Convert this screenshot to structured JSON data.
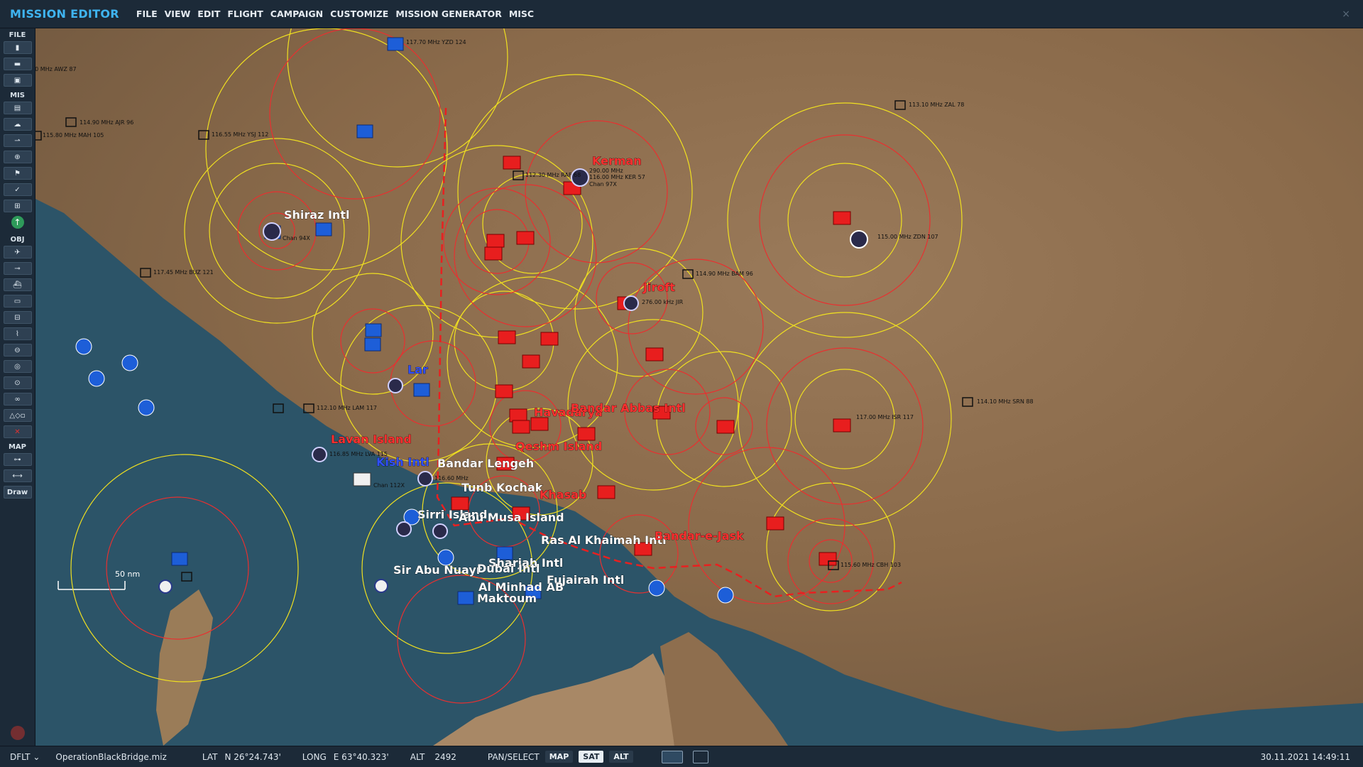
{
  "app": {
    "title": "MISSION EDITOR",
    "close_glyph": "×"
  },
  "menu": [
    "FILE",
    "VIEW",
    "EDIT",
    "FLIGHT",
    "CAMPAIGN",
    "CUSTOMIZE",
    "MISSION GENERATOR",
    "MISC"
  ],
  "toolbar": {
    "file_label": "FILE",
    "mis_label": "MIS",
    "obj_label": "OBJ",
    "map_label": "MAP",
    "draw_label": "Draw"
  },
  "map": {
    "scale_label": "50 nm",
    "places": [
      {
        "name": "Shiraz Intl",
        "color": "#ffffff"
      },
      {
        "name": "Kerman",
        "color": "#ff3030"
      },
      {
        "name": "Jiroft",
        "color": "#ff3030"
      },
      {
        "name": "Lar",
        "color": "#3050ff"
      },
      {
        "name": "Lavan Island",
        "color": "#ff3030"
      },
      {
        "name": "Kish Intl",
        "color": "#3050ff"
      },
      {
        "name": "Bandar Lengeh",
        "color": "#ffffff"
      },
      {
        "name": "Havadarya",
        "color": "#ff3030"
      },
      {
        "name": "Bandar Abbas Intl",
        "color": "#ff3030"
      },
      {
        "name": "Qeshm Island",
        "color": "#ff3030"
      },
      {
        "name": "Tunb Kochak",
        "color": "#ffffff"
      },
      {
        "name": "Khasab",
        "color": "#ff3030"
      },
      {
        "name": "Sirri Island",
        "color": "#ffffff"
      },
      {
        "name": "Abu Musa Island",
        "color": "#ffffff"
      },
      {
        "name": "Ras Al Khaimah Intl",
        "color": "#ffffff"
      },
      {
        "name": "Bandar-e-Jask",
        "color": "#ff3030"
      },
      {
        "name": "Sharjah Intl",
        "color": "#ffffff"
      },
      {
        "name": "Sir Abu Nuayr",
        "color": "#ffffff"
      },
      {
        "name": "Dubai Intl",
        "color": "#ffffff"
      },
      {
        "name": "Fujairah Intl",
        "color": "#ffffff"
      },
      {
        "name": "Al Minhad AB",
        "color": "#ffffff"
      },
      {
        "name": "Maktoum",
        "color": "#ffffff"
      }
    ],
    "navaids": [
      "117.70 MHz YZD 124",
      "114.90 MHz AJR 96",
      "115.80 MHz MAH 105",
      "116.55 MHz YSJ 112",
      "00 MHz AWZ 87",
      "113.10 MHz ZAL 78",
      "112.30 MHz RAF 68",
      "290.00 MHz",
      "116.00 MHz KER 57",
      "Chan 97X",
      "115.00 MHz ZDN 107",
      "117.45 MHz BUZ 121",
      "114.90 MHz BAM 96",
      "276.00 kHz JIR",
      "117.00 MHz ISR 117",
      "114.10 MHz SRN 88",
      "112.10 MHz LAM 117",
      "116.85 MHz LVA 115",
      "Chan 112X",
      "116.60 MHz",
      "115.60 MHz CBH 103",
      "Chan 94X"
    ]
  },
  "status": {
    "profile": "DFLT",
    "file": "OperationBlackBridge.miz",
    "lat_label": "LAT",
    "lat": "N 26°24.743'",
    "long_label": "LONG",
    "long": "E 63°40.323'",
    "alt_label": "ALT",
    "alt": "2492",
    "mode": "PAN/SELECT",
    "btn_map": "MAP",
    "btn_sat": "SAT",
    "btn_alt": "ALT",
    "datetime": "30.11.2021 14:49:11"
  }
}
